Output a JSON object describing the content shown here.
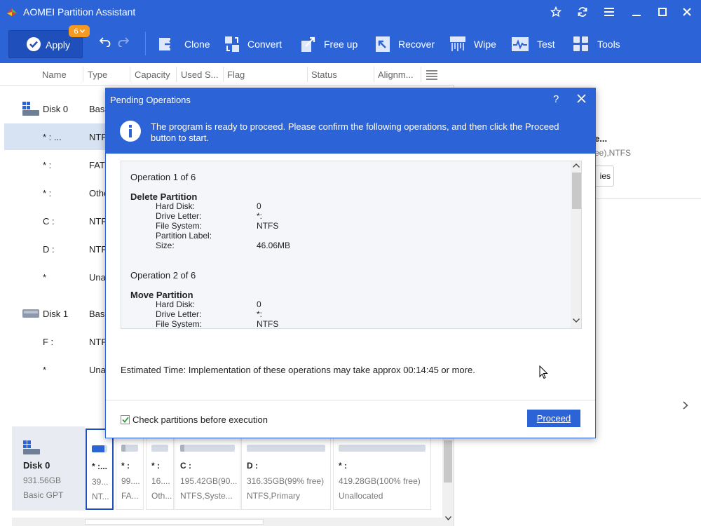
{
  "window": {
    "title": "AOMEI Partition Assistant"
  },
  "toolbar": {
    "apply_label": "Apply",
    "pending_count": "6",
    "tools": [
      {
        "label": "Clone",
        "icon": "clone-icon"
      },
      {
        "label": "Convert",
        "icon": "convert-icon"
      },
      {
        "label": "Free up",
        "icon": "free-up-icon"
      },
      {
        "label": "Recover",
        "icon": "recover-icon"
      },
      {
        "label": "Wipe",
        "icon": "wipe-icon"
      },
      {
        "label": "Test",
        "icon": "test-icon"
      },
      {
        "label": "Tools",
        "icon": "tools-icon"
      }
    ]
  },
  "table": {
    "columns": [
      "Name",
      "Type",
      "Capacity",
      "Used S...",
      "Flag",
      "Status",
      "Alignm..."
    ],
    "rows": [
      {
        "kind": "disk",
        "name": "Disk 0",
        "type": "Basi"
      },
      {
        "kind": "partition",
        "name": "* : ...",
        "type": "NTF",
        "selected": true
      },
      {
        "kind": "partition",
        "name": "* :",
        "type": "FAT"
      },
      {
        "kind": "partition",
        "name": "* :",
        "type": "Othe"
      },
      {
        "kind": "partition",
        "name": "C :",
        "type": "NTF"
      },
      {
        "kind": "partition",
        "name": "D :",
        "type": "NTF"
      },
      {
        "kind": "partition",
        "name": "*",
        "type": "Unal"
      },
      {
        "kind": "disk",
        "name": "Disk 1",
        "type": "Basi"
      },
      {
        "kind": "partition",
        "name": "F :",
        "type": "NTF"
      },
      {
        "kind": "partition",
        "name": "*",
        "type": "Unal"
      }
    ]
  },
  "disk_map": {
    "disk": {
      "name": "Disk 0",
      "size": "931.56GB",
      "type": "Basic GPT"
    },
    "partitions": [
      {
        "name": "* :...",
        "line1": "39...",
        "line2": "NT...",
        "used_fraction": 0.8,
        "selected": true
      },
      {
        "name": "* :",
        "line1": "99....",
        "line2": "FA...",
        "used_fraction": 0.25
      },
      {
        "name": "* :",
        "line1": "16....",
        "line2": "Oth...",
        "used_fraction": 0.0
      },
      {
        "name": "C :",
        "line1": "195.42GB(90...",
        "line2": "NTFS,Syste...",
        "used_fraction": 0.08
      },
      {
        "name": "D :",
        "line1": "316.35GB(99% free)",
        "line2": "NTFS,Primary",
        "used_fraction": 0.0
      },
      {
        "name": "* :",
        "line1": "419.28GB(100% free)",
        "line2": "Unallocated",
        "used_fraction": 0.0
      }
    ]
  },
  "right_pane": {
    "title_fragment": "e...",
    "subtitle_fragment": "ee),NTFS",
    "button_fragment": "ies"
  },
  "dialog": {
    "title": "Pending Operations",
    "help": "?",
    "info_text": "The program is ready to proceed. Please confirm the following operations,  and then click the Proceed button to start.",
    "operations": [
      {
        "header": "Operation 1 of 6",
        "name": "Delete Partition",
        "fields": [
          {
            "k": "Hard Disk:",
            "v": "0"
          },
          {
            "k": "Drive Letter:",
            "v": "*:"
          },
          {
            "k": "File System:",
            "v": "NTFS"
          },
          {
            "k": "Partition Label:",
            "v": ""
          },
          {
            "k": "Size:",
            "v": "46.06MB"
          }
        ]
      },
      {
        "header": "Operation 2 of 6",
        "name": "Move Partition",
        "fields": [
          {
            "k": "Hard Disk:",
            "v": "0"
          },
          {
            "k": "Drive Letter:",
            "v": "*:"
          },
          {
            "k": "File System:",
            "v": "NTFS"
          }
        ]
      }
    ],
    "estimated_time": "Estimated Time: Implementation of these operations may take approx 00:14:45 or more.",
    "check_label": "Check partitions before execution",
    "check_checked": true,
    "proceed_label": "Proceed"
  },
  "colors": {
    "accent": "#2c63d6",
    "badge": "#f59a23",
    "selection": "#d7e2f3"
  }
}
